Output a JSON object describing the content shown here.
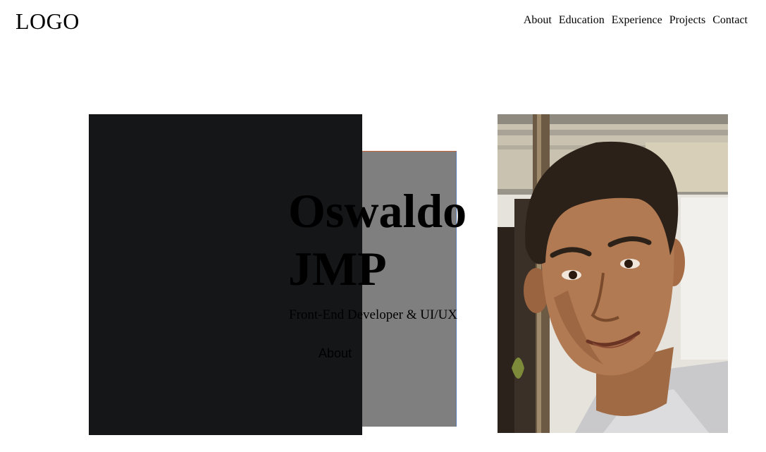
{
  "header": {
    "logo": "LOGO",
    "nav": [
      {
        "label": "About"
      },
      {
        "label": "Education"
      },
      {
        "label": "Experience"
      },
      {
        "label": "Projects"
      },
      {
        "label": "Contact"
      }
    ]
  },
  "hero": {
    "name_line1": "Oswaldo",
    "name_line2": "JMP",
    "subtitle": "Front-End Developer & UI/UX",
    "cta_label": "About"
  },
  "colors": {
    "dark_panel": "#151618",
    "gray_panel": "#7f7f7f",
    "background": "#ffffff"
  }
}
